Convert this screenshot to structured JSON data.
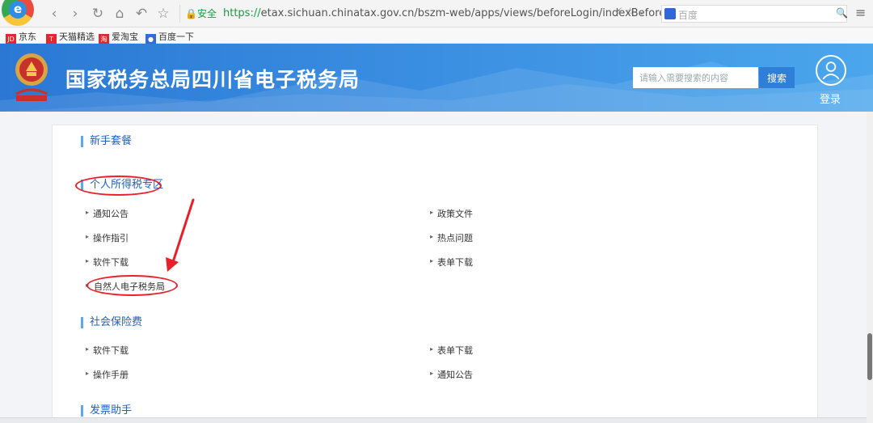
{
  "browser": {
    "secure_label": "安全",
    "url_scheme": "https://",
    "url_rest": "etax.sichuan.chinatax.gov.cn/bszm-web/apps/views/beforeLogin/indexBefore/tsf...",
    "search_engine_placeholder": "百度"
  },
  "bookmarks": [
    {
      "label": "京东",
      "color": "#e0282e"
    },
    {
      "label": "天猫精选",
      "color": "#e0282e"
    },
    {
      "label": "爱淘宝",
      "color": "#e0282e"
    },
    {
      "label": "百度一下",
      "color": "#2f6ed6"
    }
  ],
  "header": {
    "title": "国家税务总局四川省电子税务局",
    "search_placeholder": "请输入需要搜索的内容",
    "search_button": "搜索",
    "login_label": "登录"
  },
  "sections": {
    "newbie": {
      "title": "新手套餐"
    },
    "iit": {
      "title": "个人所得税专区",
      "links": {
        "notice": "通知公告",
        "policy": "政策文件",
        "guide": "操作指引",
        "hot": "热点问题",
        "software": "软件下载",
        "forms": "表单下载",
        "natural_person": "自然人电子税务局"
      }
    },
    "social": {
      "title": "社会保险费",
      "links": {
        "software": "软件下载",
        "forms": "表单下载",
        "manual": "操作手册",
        "notice": "通知公告"
      }
    },
    "invoice": {
      "title": "发票助手"
    }
  },
  "colors": {
    "header_blue": "#2a78d4",
    "section_title": "#1f62c4",
    "annotation_red": "#e8202a"
  }
}
